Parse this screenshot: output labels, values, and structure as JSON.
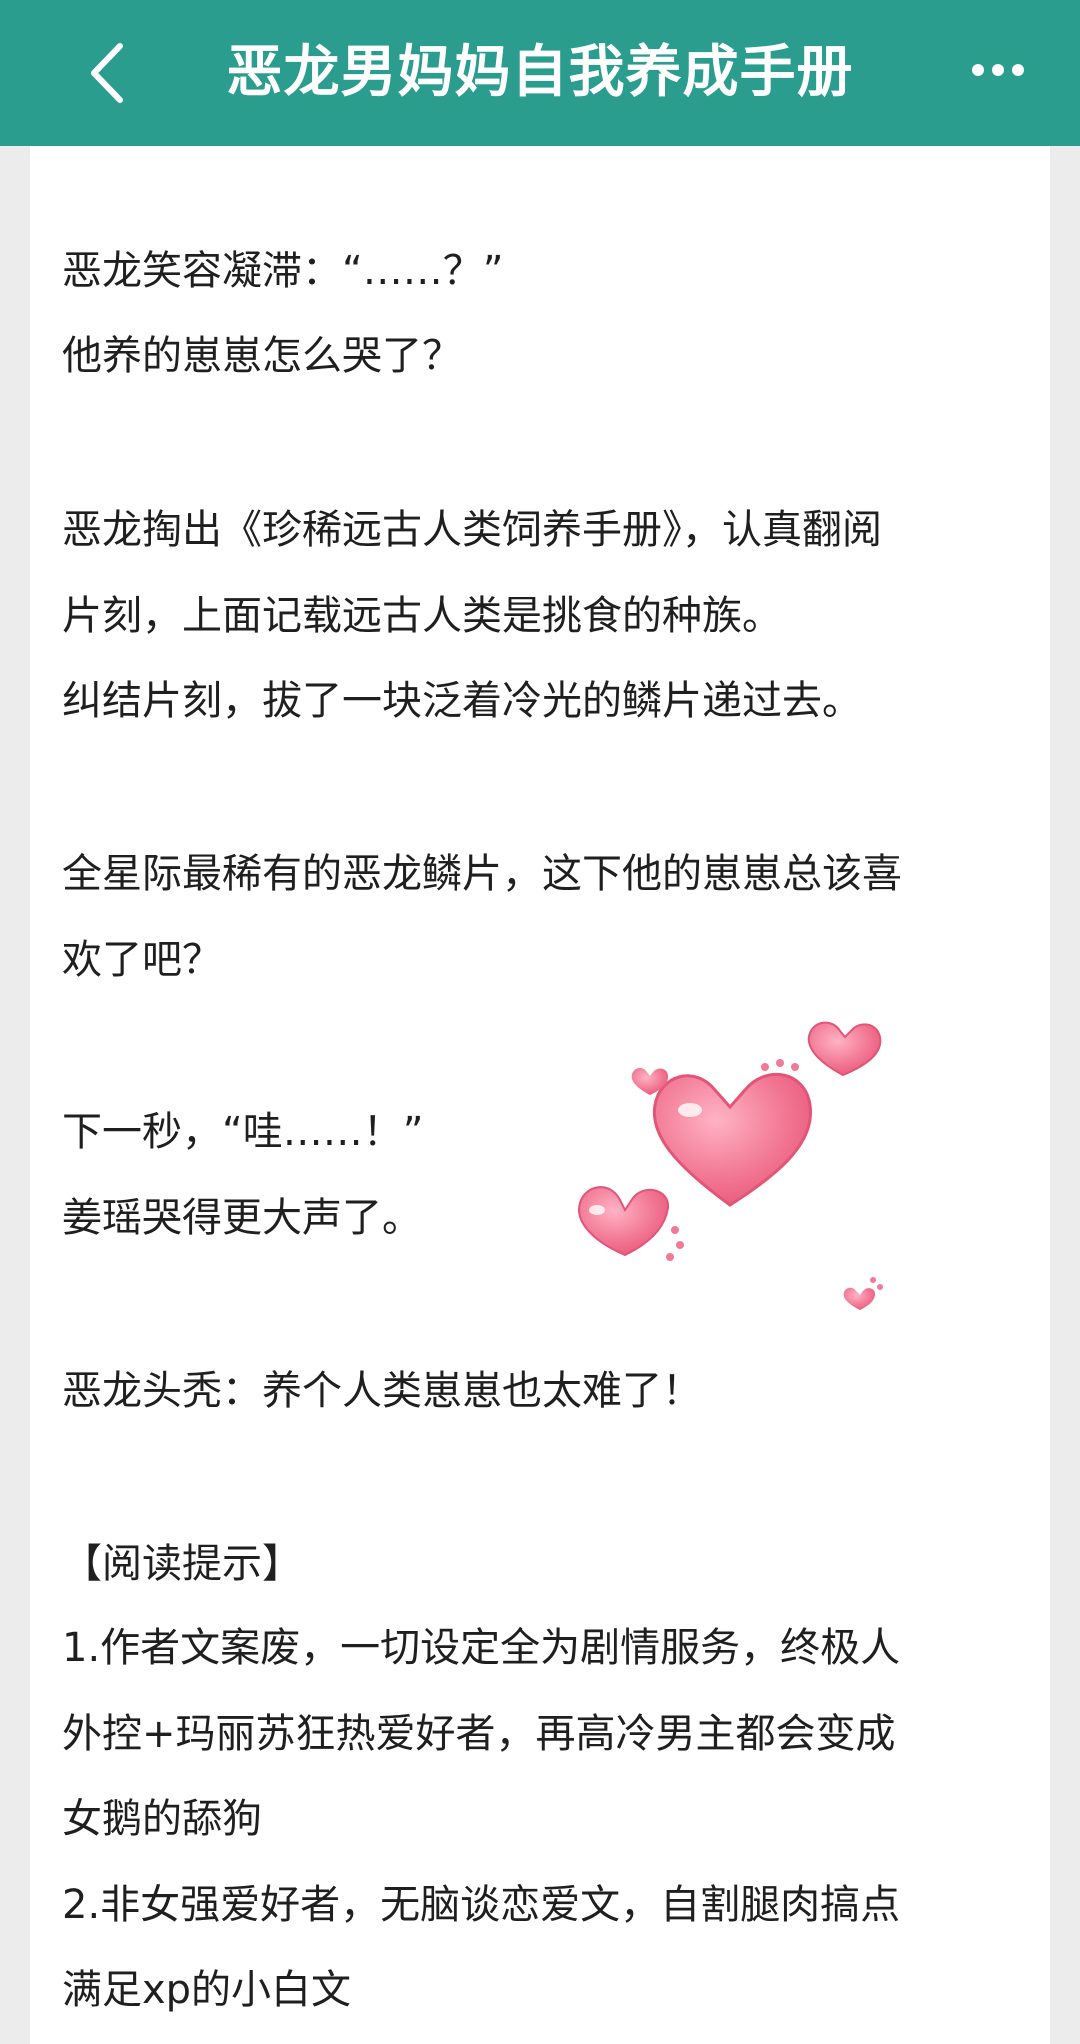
{
  "header": {
    "title": "恶龙男妈妈自我养成手册",
    "back_icon": "chevron-left-icon",
    "more_icon": "more-dots-icon",
    "bg_color": "#2a9d8f"
  },
  "article": {
    "lines": [
      "恶龙笑容凝滞：“……？”",
      "他养的崽崽怎么哭了？",
      "恶龙掏出《珍稀远古人类饲养手册》，认真翻阅",
      "片刻，上面记载远古人类是挑食的种族。",
      "纠结片刻，拔了一块泛着冷光的鳞片递过去。",
      "全星际最稀有的恶龙鳞片，这下他的崽崽总该喜",
      "欢了吧？",
      "下一秒，“哇……！”",
      "姜瑶哭得更大声了。",
      "恶龙头秃：养个人类崽崽也太难了！",
      "【阅读提示】",
      "1.作者文案废，一切设定全为剧情服务，终极人",
      "外控+玛丽苏狂热爱好者，再高冷男主都会变成",
      "女鹅的舔狗",
      "2.非女强爱好者，无脑谈恋爱文，自割腿肉搞点",
      "满足xp的小白文"
    ]
  },
  "decoration": {
    "icon": "hearts-sticker-icon",
    "color": "#f06b8a"
  }
}
